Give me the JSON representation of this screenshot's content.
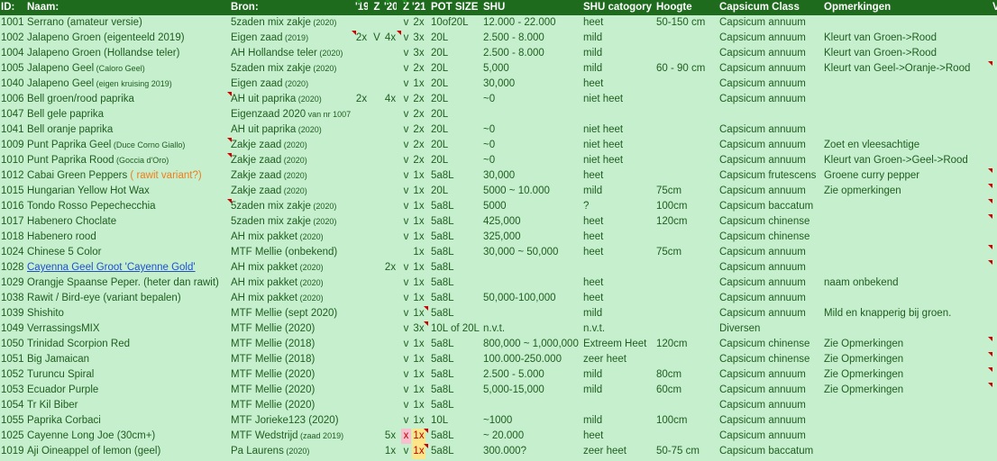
{
  "header": [
    "ID:",
    "Naam:",
    "Bron:",
    "'19",
    "Z",
    "'20",
    "Z",
    "'21",
    "POT SIZE",
    "SHU",
    "SHU catogory",
    "Hoogte",
    "Capsicum Class",
    "Opmerkingen",
    "V"
  ],
  "rows": [
    {
      "id": "1001",
      "naam": "Serrano (amateur versie)",
      "bron": "5zaden mix zakje",
      "bron_sm": " (2020)",
      "c19": "",
      "z1": "",
      "c20": "",
      "z2": "v",
      "c21": "2x",
      "pot": "10of20L",
      "shu": "12.000 - 22.000",
      "cat": "heet",
      "hoogte": "50-150 cm",
      "klass": "Capsicum annuum",
      "opm": ""
    },
    {
      "id": "1002",
      "naam": "Jalapeno Groen (eigenteeld 2019)",
      "bron": "Eigen zaad",
      "bron_sm": " (2019)",
      "c19": "2x",
      "z1": "V",
      "c20": "4x",
      "z2": "v",
      "c21": "3x",
      "pot": "20L",
      "shu": "2.500 - 8.000",
      "cat": "mild",
      "hoogte": "",
      "klass": "Capsicum annuum",
      "opm": "Kleurt van Groen->Rood"
    },
    {
      "id": "1004",
      "naam": "Jalapeno Groen (Hollandse teler)",
      "bron": "AH Hollandse teler",
      "bron_sm": " (2020)",
      "c19": "",
      "z1": "",
      "c20": "",
      "z2": "v",
      "c21": "3x",
      "pot": "20L",
      "shu": "2.500 - 8.000",
      "cat": "mild",
      "hoogte": "",
      "klass": "Capsicum annuum",
      "opm": "Kleurt van Groen->Rood"
    },
    {
      "id": "1005",
      "naam": "Jalapeno Geel",
      "naam_sm": " (Caloro Geel)",
      "bron": "5zaden mix zakje",
      "bron_sm": " (2020)",
      "c19": "",
      "z1": "",
      "c20": "",
      "z2": "v",
      "c21": "2x",
      "pot": "20L",
      "shu": "5,000",
      "cat": "mild",
      "hoogte": "60 - 90 cm",
      "klass": "Capsicum annuum",
      "opm": "Kleurt van Geel->Oranje->Rood"
    },
    {
      "id": "1040",
      "naam": "Jalapeno Geel",
      "naam_sm": " (eigen kruising 2019)",
      "bron": "Eigen zaad",
      "bron_sm": " (2020)",
      "c19": "",
      "z1": "",
      "c20": "",
      "z2": "v",
      "c21": "1x",
      "pot": "20L",
      "shu": "30,000",
      "cat": "heet",
      "hoogte": "",
      "klass": "Capsicum annuum",
      "opm": ""
    },
    {
      "id": "1006",
      "naam": "Bell groen/rood paprika",
      "bron": "AH uit paprika",
      "bron_sm": " (2020)",
      "c19": "2x",
      "z1": "",
      "c20": "4x",
      "z2": "v",
      "c21": "2x",
      "pot": "20L",
      "shu": "~0",
      "cat": "niet heet",
      "hoogte": "",
      "klass": "Capsicum annuum",
      "opm": ""
    },
    {
      "id": "1047",
      "naam": "Bell gele paprika",
      "bron": "Eigenzaad 2020",
      "bron_sm": " van nr 1007",
      "c19": "",
      "z1": "",
      "c20": "",
      "z2": "v",
      "c21": "2x",
      "pot": "20L",
      "shu": "",
      "cat": "",
      "hoogte": "",
      "klass": "",
      "opm": ""
    },
    {
      "id": "1041",
      "naam": "Bell oranje paprika",
      "bron": "AH uit paprika",
      "bron_sm": " (2020)",
      "c19": "",
      "z1": "",
      "c20": "",
      "z2": "v",
      "c21": "2x",
      "pot": "20L",
      "shu": "~0",
      "cat": "niet heet",
      "hoogte": "",
      "klass": "Capsicum annuum",
      "opm": ""
    },
    {
      "id": "1009",
      "naam": "Punt Paprika Geel",
      "naam_sm": " (Duce Corno Giallo)",
      "bron": "Zakje zaad",
      "bron_sm": " (2020)",
      "c19": "",
      "z1": "",
      "c20": "",
      "z2": "v",
      "c21": "2x",
      "pot": "20L",
      "shu": "~0",
      "cat": "niet heet",
      "hoogte": "",
      "klass": "Capsicum annuum",
      "opm": "Zoet en vleesachtige"
    },
    {
      "id": "1010",
      "naam": "Punt Paprika Rood",
      "naam_sm": " (Goccia d'Oro)",
      "bron": "Zakje zaad",
      "bron_sm": " (2020)",
      "c19": "",
      "z1": "",
      "c20": "",
      "z2": "v",
      "c21": "2x",
      "pot": "20L",
      "shu": "~0",
      "cat": "niet heet",
      "hoogte": "",
      "klass": "Capsicum annuum",
      "opm": "Kleurt van Groen->Geel->Rood"
    },
    {
      "id": "1012",
      "naam": "Cabai Green Peppers",
      "naam_or": "  ( rawit variant?)",
      "bron": "Zakje zaad",
      "bron_sm": " (2020)",
      "c19": "",
      "z1": "",
      "c20": "",
      "z2": "v",
      "c21": "1x",
      "pot": "5a8L",
      "shu": "30,000",
      "cat": "heet",
      "hoogte": "",
      "klass": "Capsicum frutescens",
      "opm": "Groene curry pepper"
    },
    {
      "id": "1015",
      "naam": "Hungarian Yellow Hot Wax",
      "bron": "Zakje zaad",
      "bron_sm": " (2020)",
      "c19": "",
      "z1": "",
      "c20": "",
      "z2": "v",
      "c21": "1x",
      "pot": "20L",
      "shu": "5000 ~ 10.000",
      "cat": "mild",
      "hoogte": "75cm",
      "klass": "Capsicum annuum",
      "opm": "Zie opmerkingen"
    },
    {
      "id": "1016",
      "naam": "Tondo Rosso Pepechecchia",
      "bron": "5zaden mix zakje",
      "bron_sm": " (2020)",
      "c19": "",
      "z1": "",
      "c20": "",
      "z2": "v",
      "c21": "1x",
      "pot": "5a8L",
      "shu": "5000",
      "cat": "?",
      "hoogte": "100cm",
      "klass": "Capsicum baccatum",
      "opm": ""
    },
    {
      "id": "1017",
      "naam": "Habenero Choclate",
      "bron": "5zaden mix zakje",
      "bron_sm": " (2020)",
      "c19": "",
      "z1": "",
      "c20": "",
      "z2": "v",
      "c21": "1x",
      "pot": "5a8L",
      "shu": "425,000",
      "cat": "heet",
      "hoogte": "120cm",
      "klass": "Capsicum chinense",
      "opm": ""
    },
    {
      "id": "1018",
      "naam": "Habenero rood",
      "bron": "AH mix pakket",
      "bron_sm": " (2020)",
      "c19": "",
      "z1": "",
      "c20": "",
      "z2": "v",
      "c21": "1x",
      "pot": "5a8L",
      "shu": "325,000",
      "cat": "heet",
      "hoogte": "",
      "klass": "Capsicum chinense",
      "opm": ""
    },
    {
      "id": "1024",
      "naam": "Chinese 5 Color",
      "bron": "MTF Mellie (onbekend)",
      "bron_sm": "",
      "c19": "",
      "z1": "",
      "c20": "",
      "z2": "",
      "c21": "1x",
      "pot": "5a8L",
      "shu": "30,000 ~ 50,000",
      "cat": "heet",
      "hoogte": "75cm",
      "klass": "Capsicum annuum",
      "opm": ""
    },
    {
      "id": "1028",
      "naam": "Cayenna Geel Groot 'Cayenne Gold'",
      "bron": "AH mix pakket",
      "bron_sm": " (2020)",
      "c19": "",
      "z1": "",
      "c20": "2x",
      "z2": "v",
      "c21": "1x",
      "pot": "5a8L",
      "shu": "",
      "cat": "",
      "hoogte": "",
      "klass": "Capsicum annuum",
      "opm": ""
    },
    {
      "id": "1029",
      "naam": "Orangje Spaanse Peper. (heter dan rawit)",
      "bron": "AH mix pakket",
      "bron_sm": " (2020)",
      "c19": "",
      "z1": "",
      "c20": "",
      "z2": "v",
      "c21": "1x",
      "pot": "5a8L",
      "shu": "",
      "cat": "heet",
      "hoogte": "",
      "klass": "Capsicum annuum",
      "opm": "naam onbekend"
    },
    {
      "id": "1038",
      "naam": "Rawit / Bird-eye  (variant bepalen)",
      "bron": "AH mix pakket",
      "bron_sm": " (2020)",
      "c19": "",
      "z1": "",
      "c20": "",
      "z2": "v",
      "c21": "1x",
      "pot": "5a8L",
      "shu": "50,000-100,000",
      "cat": "heet",
      "hoogte": "",
      "klass": "Capsicum annuum",
      "opm": ""
    },
    {
      "id": "1039",
      "naam": "Shishito",
      "bron": "MTF Mellie (sept 2020)",
      "bron_sm": "",
      "c19": "",
      "z1": "",
      "c20": "",
      "z2": "v",
      "c21": "1x",
      "pot": "5a8L",
      "shu": "",
      "cat": "mild",
      "hoogte": "",
      "klass": "Capsicum annuum",
      "opm": "Mild en knapperig bij groen."
    },
    {
      "id": "1049",
      "naam": "VerrassingsMIX",
      "bron": "MTF Mellie (2020)",
      "bron_sm": "",
      "c19": "",
      "z1": "",
      "c20": "",
      "z2": "v",
      "c21": "3x",
      "pot": "10L of 20L",
      "shu": "n.v.t.",
      "cat": "n.v.t.",
      "hoogte": "",
      "klass": "Diversen",
      "opm": ""
    },
    {
      "id": "1050",
      "naam": "Trinidad Scorpion Red",
      "bron": "MTF Mellie (2018)",
      "bron_sm": "",
      "c19": "",
      "z1": "",
      "c20": "",
      "z2": "v",
      "c21": "1x",
      "pot": "5a8L",
      "shu": "800,000 ~ 1,000,000",
      "cat": "Extreem Heet",
      "hoogte": "120cm",
      "klass": "Capsicum chinense",
      "opm": "Zie Opmerkingen"
    },
    {
      "id": "1051",
      "naam": "Big Jamaican",
      "bron": "MTF Mellie (2018)",
      "bron_sm": "",
      "c19": "",
      "z1": "",
      "c20": "",
      "z2": "v",
      "c21": "1x",
      "pot": "5a8L",
      "shu": "100.000-250.000",
      "cat": "zeer heet",
      "hoogte": "",
      "klass": "Capsicum chinense",
      "opm": "Zie Opmerkingen"
    },
    {
      "id": "1052",
      "naam": "Turuncu Spiral",
      "bron": "MTF Mellie (2020)",
      "bron_sm": "",
      "c19": "",
      "z1": "",
      "c20": "",
      "z2": "v",
      "c21": "1x",
      "pot": "5a8L",
      "shu": "2.500 - 5.000",
      "cat": "mild",
      "hoogte": "80cm",
      "klass": "Capsicum annuum",
      "opm": "Zie Opmerkingen"
    },
    {
      "id": "1053",
      "naam": "Ecuador Purple",
      "bron": "MTF Mellie (2020)",
      "bron_sm": "",
      "c19": "",
      "z1": "",
      "c20": "",
      "z2": "v",
      "c21": "1x",
      "pot": "5a8L",
      "shu": " 5,000-15,000",
      "cat": "mild",
      "hoogte": "60cm",
      "klass": "Capsicum annuum",
      "opm": "Zie Opmerkingen"
    },
    {
      "id": "1054",
      "naam": "Tr Kil Biber",
      "bron": "MTF Mellie (2020)",
      "bron_sm": "",
      "c19": "",
      "z1": "",
      "c20": "",
      "z2": "v",
      "c21": "1x",
      "pot": "5a8L",
      "shu": "",
      "cat": "",
      "hoogte": "",
      "klass": "Capsicum annuum",
      "opm": ""
    },
    {
      "id": "1055",
      "naam": "Paprika Corbaci",
      "bron": "MTF Jorieke123 (2020)",
      "bron_sm": "",
      "c19": "",
      "z1": "",
      "c20": "",
      "z2": "v",
      "c21": "1x",
      "pot": "10L",
      "shu": "~1000",
      "cat": "mild",
      "hoogte": "100cm",
      "klass": "Capsicum annuum",
      "opm": ""
    },
    {
      "id": "1025",
      "naam": "Cayenne Long Joe (30cm+)",
      "bron": "MTF Wedstrijd",
      "bron_sm": " (zaad 2019)",
      "c19": "",
      "z1": "",
      "c20": "5x",
      "z2": "x",
      "c21": "1x",
      "pot": "5a8L",
      "shu": "~ 20.000",
      "cat": "heet",
      "hoogte": "",
      "klass": "Capsicum annuum",
      "opm": ""
    },
    {
      "id": "1019",
      "naam": "Aji Oineappel of lemon (geel)",
      "bron": "Pa Laurens",
      "bron_sm": " (2020)",
      "c19": "",
      "z1": "",
      "c20": "1x",
      "z2": "v",
      "c21": "1x",
      "pot": "5a8L",
      "shu": "300.000?",
      "cat": "zeer heet",
      "hoogte": "50-75 cm",
      "klass": "Capsicum baccatum",
      "opm": ""
    }
  ],
  "colors": {
    "cell_bg": "#c6efce",
    "text": "#1e5e1e",
    "header_bg": "#1e6b1e",
    "header_text": "#ffffff",
    "comment_marker": "#d10000",
    "link": "#1f4fd1"
  }
}
